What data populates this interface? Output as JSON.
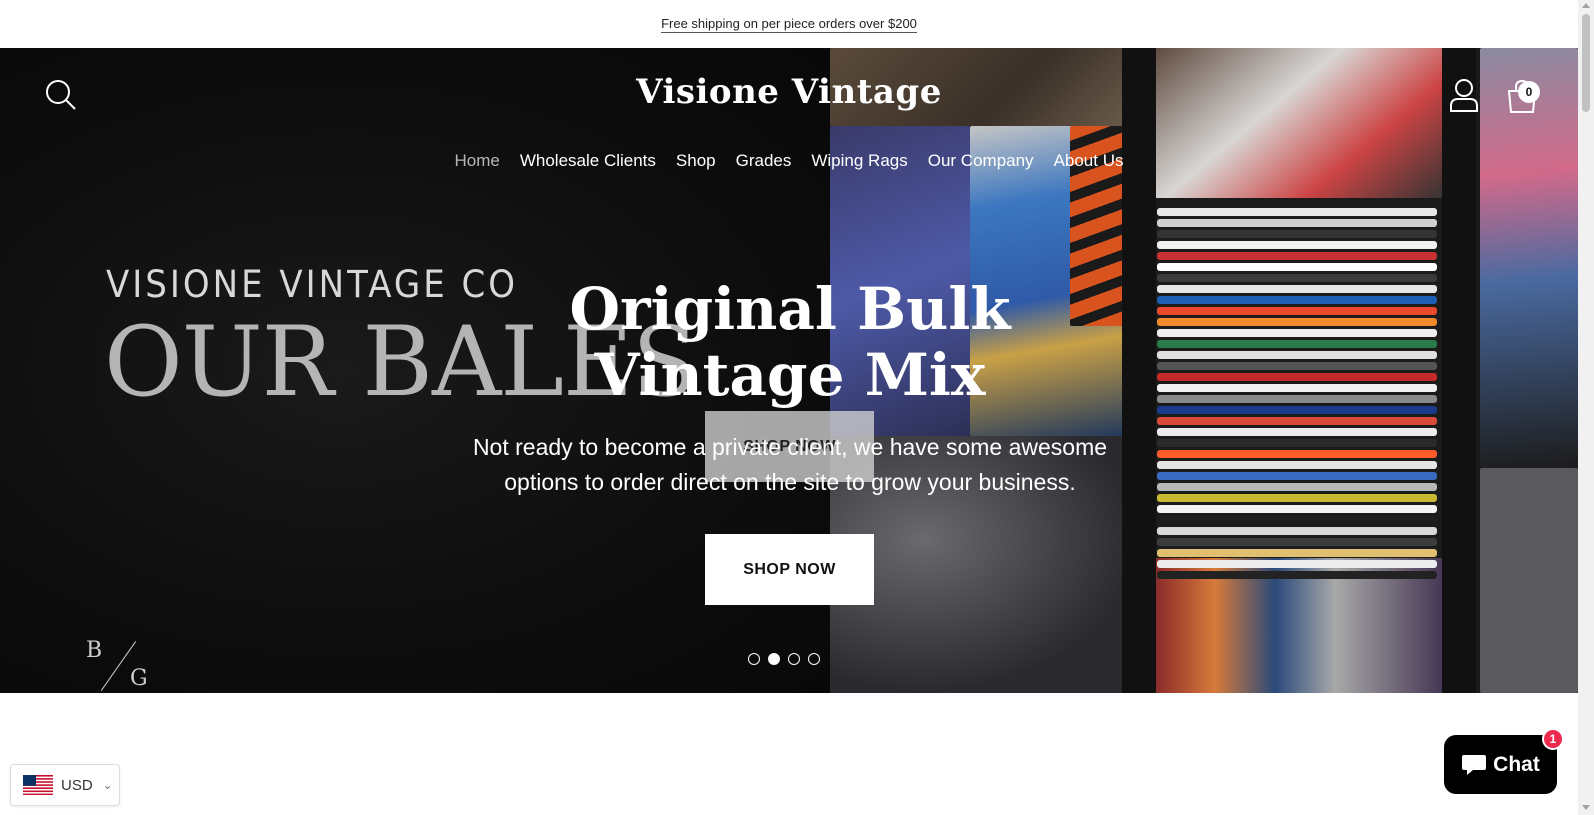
{
  "announcement": {
    "text": "Free shipping on per piece orders over $200"
  },
  "header": {
    "logo": "Visione Vintage",
    "cart_count": "0"
  },
  "nav": {
    "items": [
      {
        "label": "Home",
        "active": true
      },
      {
        "label": "Wholesale Clients"
      },
      {
        "label": "Shop"
      },
      {
        "label": "Grades"
      },
      {
        "label": "Wiping Rags"
      },
      {
        "label": "Our Company"
      },
      {
        "label": "About Us"
      }
    ]
  },
  "hero": {
    "background_text": {
      "brand": "VISIONE VINTAGE CO",
      "headline": "OUR BALES",
      "mark_left": "B",
      "mark_right": "G"
    },
    "ghost_button": "SHOP NOW",
    "title": "Original Bulk Vintage Mix",
    "subtitle": "Not ready to become a private client, we have some awesome options to order direct on the site to grow your business.",
    "button": "SHOP NOW",
    "slides": {
      "count": 4,
      "active_index": 1
    }
  },
  "currency": {
    "code": "USD",
    "flag": "us-flag-icon"
  },
  "chat": {
    "label": "Chat",
    "badge": "1"
  },
  "colors": {
    "hero_bg": "#0b0b0b",
    "chat_badge": "#ee2a4f",
    "nav_active": "#b7b7b7"
  }
}
